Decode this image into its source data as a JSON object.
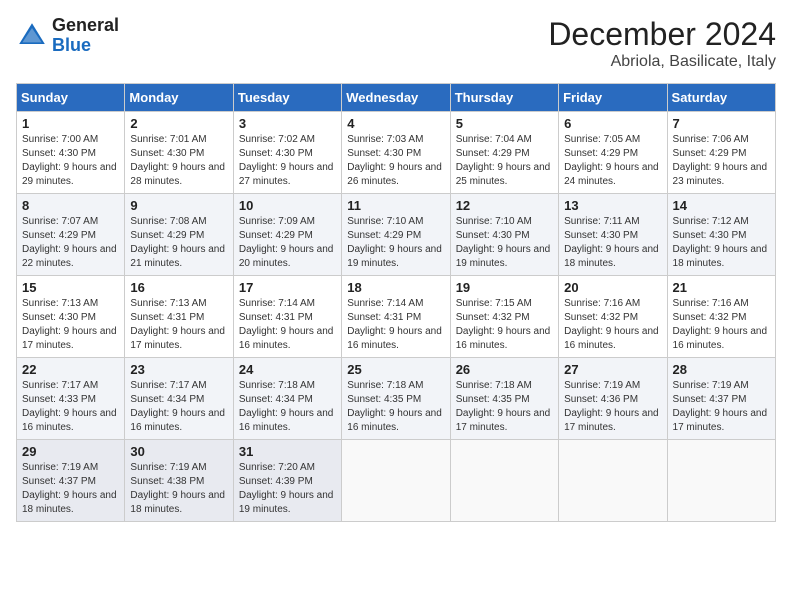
{
  "header": {
    "logo_general": "General",
    "logo_blue": "Blue",
    "title": "December 2024",
    "subtitle": "Abriola, Basilicate, Italy"
  },
  "days_of_week": [
    "Sunday",
    "Monday",
    "Tuesday",
    "Wednesday",
    "Thursday",
    "Friday",
    "Saturday"
  ],
  "weeks": [
    [
      {
        "day": "1",
        "sunrise": "7:00 AM",
        "sunset": "4:30 PM",
        "daylight": "9 hours and 29 minutes."
      },
      {
        "day": "2",
        "sunrise": "7:01 AM",
        "sunset": "4:30 PM",
        "daylight": "9 hours and 28 minutes."
      },
      {
        "day": "3",
        "sunrise": "7:02 AM",
        "sunset": "4:30 PM",
        "daylight": "9 hours and 27 minutes."
      },
      {
        "day": "4",
        "sunrise": "7:03 AM",
        "sunset": "4:30 PM",
        "daylight": "9 hours and 26 minutes."
      },
      {
        "day": "5",
        "sunrise": "7:04 AM",
        "sunset": "4:29 PM",
        "daylight": "9 hours and 25 minutes."
      },
      {
        "day": "6",
        "sunrise": "7:05 AM",
        "sunset": "4:29 PM",
        "daylight": "9 hours and 24 minutes."
      },
      {
        "day": "7",
        "sunrise": "7:06 AM",
        "sunset": "4:29 PM",
        "daylight": "9 hours and 23 minutes."
      }
    ],
    [
      {
        "day": "8",
        "sunrise": "7:07 AM",
        "sunset": "4:29 PM",
        "daylight": "9 hours and 22 minutes."
      },
      {
        "day": "9",
        "sunrise": "7:08 AM",
        "sunset": "4:29 PM",
        "daylight": "9 hours and 21 minutes."
      },
      {
        "day": "10",
        "sunrise": "7:09 AM",
        "sunset": "4:29 PM",
        "daylight": "9 hours and 20 minutes."
      },
      {
        "day": "11",
        "sunrise": "7:10 AM",
        "sunset": "4:29 PM",
        "daylight": "9 hours and 19 minutes."
      },
      {
        "day": "12",
        "sunrise": "7:10 AM",
        "sunset": "4:30 PM",
        "daylight": "9 hours and 19 minutes."
      },
      {
        "day": "13",
        "sunrise": "7:11 AM",
        "sunset": "4:30 PM",
        "daylight": "9 hours and 18 minutes."
      },
      {
        "day": "14",
        "sunrise": "7:12 AM",
        "sunset": "4:30 PM",
        "daylight": "9 hours and 18 minutes."
      }
    ],
    [
      {
        "day": "15",
        "sunrise": "7:13 AM",
        "sunset": "4:30 PM",
        "daylight": "9 hours and 17 minutes."
      },
      {
        "day": "16",
        "sunrise": "7:13 AM",
        "sunset": "4:31 PM",
        "daylight": "9 hours and 17 minutes."
      },
      {
        "day": "17",
        "sunrise": "7:14 AM",
        "sunset": "4:31 PM",
        "daylight": "9 hours and 16 minutes."
      },
      {
        "day": "18",
        "sunrise": "7:14 AM",
        "sunset": "4:31 PM",
        "daylight": "9 hours and 16 minutes."
      },
      {
        "day": "19",
        "sunrise": "7:15 AM",
        "sunset": "4:32 PM",
        "daylight": "9 hours and 16 minutes."
      },
      {
        "day": "20",
        "sunrise": "7:16 AM",
        "sunset": "4:32 PM",
        "daylight": "9 hours and 16 minutes."
      },
      {
        "day": "21",
        "sunrise": "7:16 AM",
        "sunset": "4:32 PM",
        "daylight": "9 hours and 16 minutes."
      }
    ],
    [
      {
        "day": "22",
        "sunrise": "7:17 AM",
        "sunset": "4:33 PM",
        "daylight": "9 hours and 16 minutes."
      },
      {
        "day": "23",
        "sunrise": "7:17 AM",
        "sunset": "4:34 PM",
        "daylight": "9 hours and 16 minutes."
      },
      {
        "day": "24",
        "sunrise": "7:18 AM",
        "sunset": "4:34 PM",
        "daylight": "9 hours and 16 minutes."
      },
      {
        "day": "25",
        "sunrise": "7:18 AM",
        "sunset": "4:35 PM",
        "daylight": "9 hours and 16 minutes."
      },
      {
        "day": "26",
        "sunrise": "7:18 AM",
        "sunset": "4:35 PM",
        "daylight": "9 hours and 17 minutes."
      },
      {
        "day": "27",
        "sunrise": "7:19 AM",
        "sunset": "4:36 PM",
        "daylight": "9 hours and 17 minutes."
      },
      {
        "day": "28",
        "sunrise": "7:19 AM",
        "sunset": "4:37 PM",
        "daylight": "9 hours and 17 minutes."
      }
    ],
    [
      {
        "day": "29",
        "sunrise": "7:19 AM",
        "sunset": "4:37 PM",
        "daylight": "9 hours and 18 minutes."
      },
      {
        "day": "30",
        "sunrise": "7:19 AM",
        "sunset": "4:38 PM",
        "daylight": "9 hours and 18 minutes."
      },
      {
        "day": "31",
        "sunrise": "7:20 AM",
        "sunset": "4:39 PM",
        "daylight": "9 hours and 19 minutes."
      },
      null,
      null,
      null,
      null
    ]
  ],
  "labels": {
    "sunrise": "Sunrise:",
    "sunset": "Sunset:",
    "daylight": "Daylight:"
  }
}
